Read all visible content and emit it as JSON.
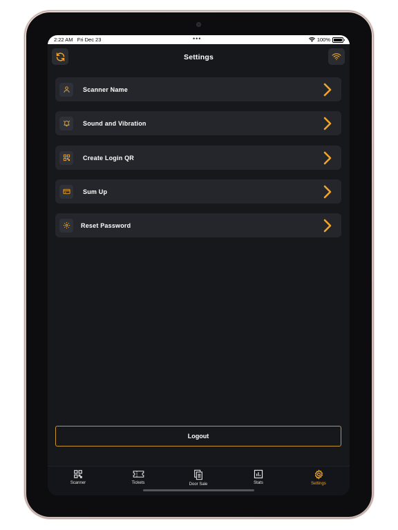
{
  "status": {
    "time": "2:22 AM",
    "date": "Fri Dec 23",
    "dots": "•••",
    "battery": "100%"
  },
  "header": {
    "title": "Settings",
    "refresh_icon": "refresh-icon",
    "wifi_icon": "wifi-icon"
  },
  "settings": {
    "items": [
      {
        "label": "Scanner Name",
        "icon": "user-icon"
      },
      {
        "label": "Sound and Vibration",
        "icon": "bell-icon"
      },
      {
        "label": "Create Login QR",
        "icon": "qr-code-icon"
      },
      {
        "label": "Sum Up",
        "icon": "card-icon"
      },
      {
        "label": "Reset Password",
        "icon": "gear-icon"
      }
    ]
  },
  "logout_label": "Logout",
  "tabs": [
    {
      "label": "Scanner",
      "icon": "qr-code-icon",
      "active": false
    },
    {
      "label": "Tickets",
      "icon": "ticket-icon",
      "active": false
    },
    {
      "label": "Door Sale",
      "icon": "documents-icon",
      "active": false
    },
    {
      "label": "Stats",
      "icon": "bar-chart-icon",
      "active": false
    },
    {
      "label": "Settings",
      "icon": "gear-icon",
      "active": true
    }
  ],
  "colors": {
    "accent": "#f0a52b",
    "background": "#17181c",
    "row": "#24262c",
    "logout_border": "#c8962c"
  }
}
